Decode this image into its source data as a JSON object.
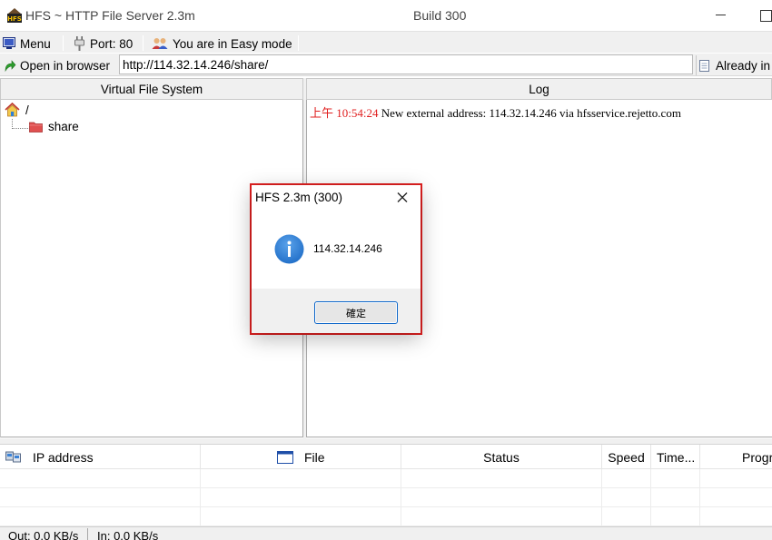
{
  "window": {
    "title": "HFS ~ HTTP File Server 2.3m",
    "build": "Build 300",
    "logo_text": "HFS"
  },
  "toolbar": {
    "menu_label": "Menu",
    "port_label": "Port: 80",
    "mode_label": "You are in Easy mode"
  },
  "addressbar": {
    "open_in_browser_label": "Open in browser",
    "url": "http://114.32.14.246/share/",
    "already_in_label": "Already in"
  },
  "vfs": {
    "header": "Virtual File System",
    "root_label": "/",
    "items": [
      {
        "label": "share",
        "icon": "folder-icon"
      }
    ]
  },
  "log": {
    "header": "Log",
    "entries": [
      {
        "time": "上午 10:54:24",
        "message": "New external address: 114.32.14.246 via hfsservice.rejetto.com"
      }
    ]
  },
  "connections": {
    "columns": [
      "IP address",
      "File",
      "Status",
      "Speed",
      "Time...",
      "Progr"
    ]
  },
  "status": {
    "out": "Out: 0.0 KB/s",
    "in": "In: 0.0 KB/s"
  },
  "dialog": {
    "title": "HFS 2.3m (300)",
    "message": "114.32.14.246",
    "ok_label": "確定",
    "icon": "info-icon"
  },
  "colors": {
    "log_time": "#e02020",
    "highlight": "#e02020",
    "info_icon": "#2f7fd6",
    "folder": "#e05050"
  }
}
